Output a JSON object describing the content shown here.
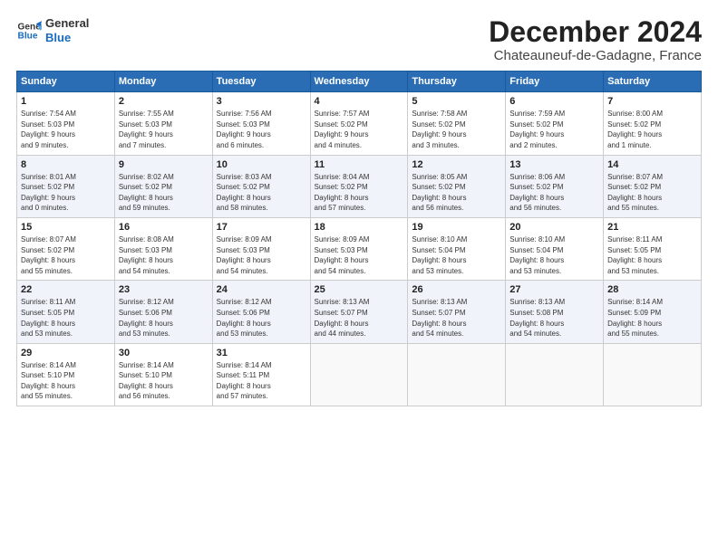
{
  "logo": {
    "line1": "General",
    "line2": "Blue"
  },
  "title": "December 2024",
  "location": "Chateauneuf-de-Gadagne, France",
  "weekdays": [
    "Sunday",
    "Monday",
    "Tuesday",
    "Wednesday",
    "Thursday",
    "Friday",
    "Saturday"
  ],
  "weeks": [
    [
      {
        "day": "1",
        "info": "Sunrise: 7:54 AM\nSunset: 5:03 PM\nDaylight: 9 hours\nand 9 minutes."
      },
      {
        "day": "2",
        "info": "Sunrise: 7:55 AM\nSunset: 5:03 PM\nDaylight: 9 hours\nand 7 minutes."
      },
      {
        "day": "3",
        "info": "Sunrise: 7:56 AM\nSunset: 5:03 PM\nDaylight: 9 hours\nand 6 minutes."
      },
      {
        "day": "4",
        "info": "Sunrise: 7:57 AM\nSunset: 5:02 PM\nDaylight: 9 hours\nand 4 minutes."
      },
      {
        "day": "5",
        "info": "Sunrise: 7:58 AM\nSunset: 5:02 PM\nDaylight: 9 hours\nand 3 minutes."
      },
      {
        "day": "6",
        "info": "Sunrise: 7:59 AM\nSunset: 5:02 PM\nDaylight: 9 hours\nand 2 minutes."
      },
      {
        "day": "7",
        "info": "Sunrise: 8:00 AM\nSunset: 5:02 PM\nDaylight: 9 hours\nand 1 minute."
      }
    ],
    [
      {
        "day": "8",
        "info": "Sunrise: 8:01 AM\nSunset: 5:02 PM\nDaylight: 9 hours\nand 0 minutes."
      },
      {
        "day": "9",
        "info": "Sunrise: 8:02 AM\nSunset: 5:02 PM\nDaylight: 8 hours\nand 59 minutes."
      },
      {
        "day": "10",
        "info": "Sunrise: 8:03 AM\nSunset: 5:02 PM\nDaylight: 8 hours\nand 58 minutes."
      },
      {
        "day": "11",
        "info": "Sunrise: 8:04 AM\nSunset: 5:02 PM\nDaylight: 8 hours\nand 57 minutes."
      },
      {
        "day": "12",
        "info": "Sunrise: 8:05 AM\nSunset: 5:02 PM\nDaylight: 8 hours\nand 56 minutes."
      },
      {
        "day": "13",
        "info": "Sunrise: 8:06 AM\nSunset: 5:02 PM\nDaylight: 8 hours\nand 56 minutes."
      },
      {
        "day": "14",
        "info": "Sunrise: 8:07 AM\nSunset: 5:02 PM\nDaylight: 8 hours\nand 55 minutes."
      }
    ],
    [
      {
        "day": "15",
        "info": "Sunrise: 8:07 AM\nSunset: 5:02 PM\nDaylight: 8 hours\nand 55 minutes."
      },
      {
        "day": "16",
        "info": "Sunrise: 8:08 AM\nSunset: 5:03 PM\nDaylight: 8 hours\nand 54 minutes."
      },
      {
        "day": "17",
        "info": "Sunrise: 8:09 AM\nSunset: 5:03 PM\nDaylight: 8 hours\nand 54 minutes."
      },
      {
        "day": "18",
        "info": "Sunrise: 8:09 AM\nSunset: 5:03 PM\nDaylight: 8 hours\nand 54 minutes."
      },
      {
        "day": "19",
        "info": "Sunrise: 8:10 AM\nSunset: 5:04 PM\nDaylight: 8 hours\nand 53 minutes."
      },
      {
        "day": "20",
        "info": "Sunrise: 8:10 AM\nSunset: 5:04 PM\nDaylight: 8 hours\nand 53 minutes."
      },
      {
        "day": "21",
        "info": "Sunrise: 8:11 AM\nSunset: 5:05 PM\nDaylight: 8 hours\nand 53 minutes."
      }
    ],
    [
      {
        "day": "22",
        "info": "Sunrise: 8:11 AM\nSunset: 5:05 PM\nDaylight: 8 hours\nand 53 minutes."
      },
      {
        "day": "23",
        "info": "Sunrise: 8:12 AM\nSunset: 5:06 PM\nDaylight: 8 hours\nand 53 minutes."
      },
      {
        "day": "24",
        "info": "Sunrise: 8:12 AM\nSunset: 5:06 PM\nDaylight: 8 hours\nand 53 minutes."
      },
      {
        "day": "25",
        "info": "Sunrise: 8:13 AM\nSunset: 5:07 PM\nDaylight: 8 hours\nand 44 minutes."
      },
      {
        "day": "26",
        "info": "Sunrise: 8:13 AM\nSunset: 5:07 PM\nDaylight: 8 hours\nand 54 minutes."
      },
      {
        "day": "27",
        "info": "Sunrise: 8:13 AM\nSunset: 5:08 PM\nDaylight: 8 hours\nand 54 minutes."
      },
      {
        "day": "28",
        "info": "Sunrise: 8:14 AM\nSunset: 5:09 PM\nDaylight: 8 hours\nand 55 minutes."
      }
    ],
    [
      {
        "day": "29",
        "info": "Sunrise: 8:14 AM\nSunset: 5:10 PM\nDaylight: 8 hours\nand 55 minutes."
      },
      {
        "day": "30",
        "info": "Sunrise: 8:14 AM\nSunset: 5:10 PM\nDaylight: 8 hours\nand 56 minutes."
      },
      {
        "day": "31",
        "info": "Sunrise: 8:14 AM\nSunset: 5:11 PM\nDaylight: 8 hours\nand 57 minutes."
      },
      null,
      null,
      null,
      null
    ]
  ]
}
